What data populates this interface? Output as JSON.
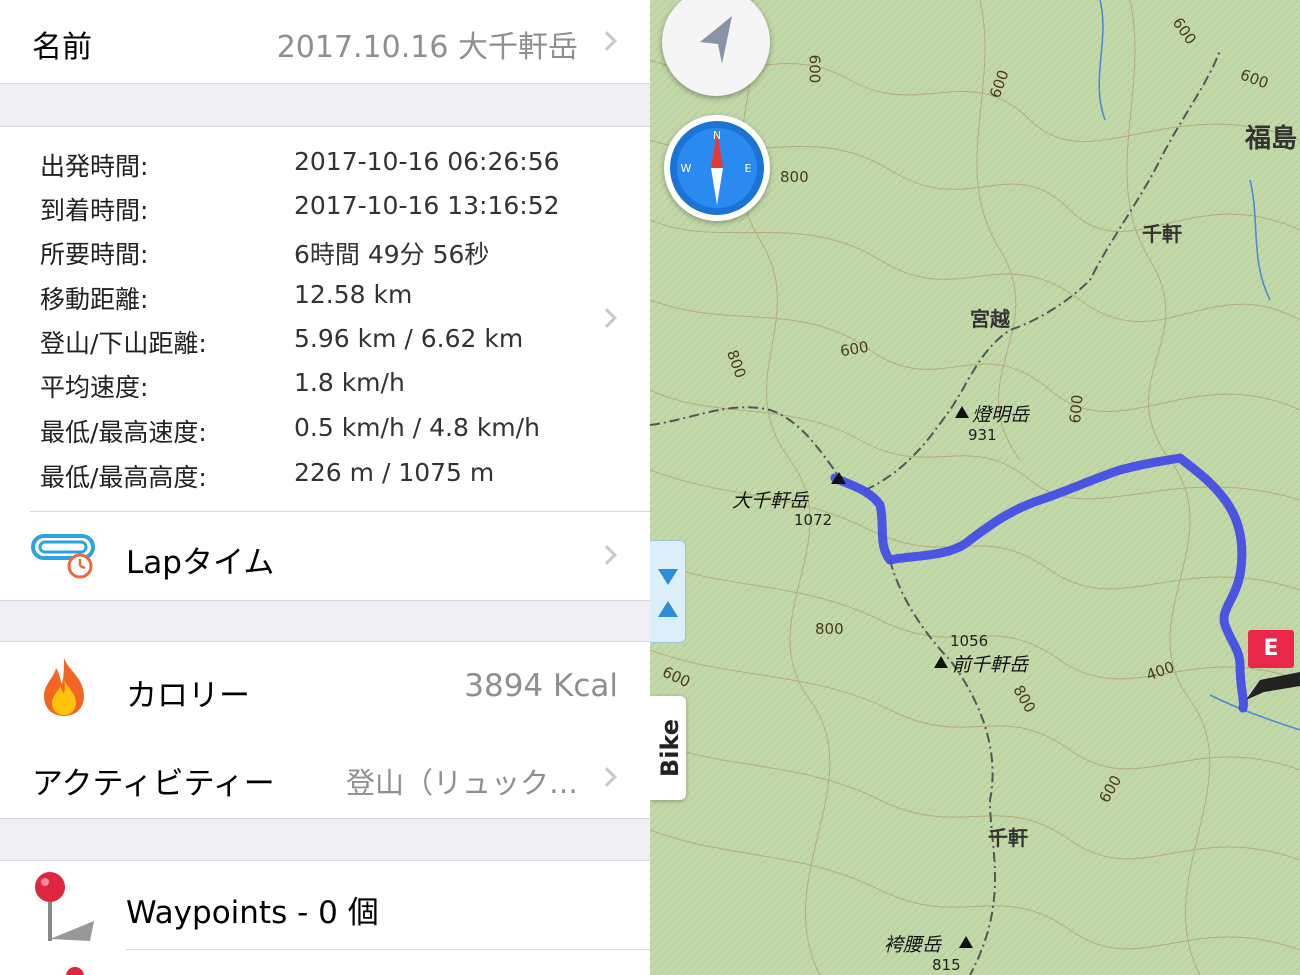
{
  "name_row": {
    "label": "名前",
    "value": "2017.10.16 大千軒岳"
  },
  "stats": {
    "depart_label": "出発時間:",
    "depart_value": "2017-10-16 06:26:56",
    "arrive_label": "到着時間:",
    "arrive_value": "2017-10-16 13:16:52",
    "duration_label": "所要時間:",
    "duration_value": "6時間 49分 56秒",
    "distance_label": "移動距離:",
    "distance_value": "12.58 km",
    "updown_label": "登山/下山距離:",
    "updown_value": "5.96 km / 6.62 km",
    "avg_speed_label": "平均速度:",
    "avg_speed_value": "1.8 km/h",
    "minmax_speed_label": "最低/最高速度:",
    "minmax_speed_value": "0.5 km/h / 4.8 km/h",
    "minmax_alt_label": "最低/最高高度:",
    "minmax_alt_value": "226 m / 1075 m"
  },
  "lap": {
    "label": "Lapタイム",
    "icon": "lap-timer-icon"
  },
  "calories": {
    "label": "カロリー",
    "value": "3894 Kcal",
    "icon": "flame-icon"
  },
  "activity": {
    "label": "アクティビティー",
    "value": "登山（リュック…"
  },
  "waypoints": {
    "label": "Waypoints - 0 個",
    "icon": "map-pin-icon"
  },
  "map": {
    "contours": [
      "600",
      "600",
      "600",
      "800",
      "600",
      "600",
      "800",
      "600",
      "800",
      "600",
      "800",
      "400",
      "600"
    ],
    "places": {
      "fukushima": "福島",
      "sengen_north": "千軒",
      "miyakoshi": "宮越",
      "sengen_south": "千軒"
    },
    "peaks": {
      "toumyo": {
        "name": "燈明岳",
        "elev": "931"
      },
      "daisengen": {
        "name": "大千軒岳",
        "elev": "1072"
      },
      "maesengen": {
        "name": "前千軒岳",
        "elev": "1056"
      },
      "hakamagoshi": {
        "name": "袴腰岳",
        "elev": "815"
      }
    },
    "end_marker": "E",
    "bike_tab": "Bike",
    "route_color": "#3d47e8",
    "marker_color": "#e8274b"
  }
}
